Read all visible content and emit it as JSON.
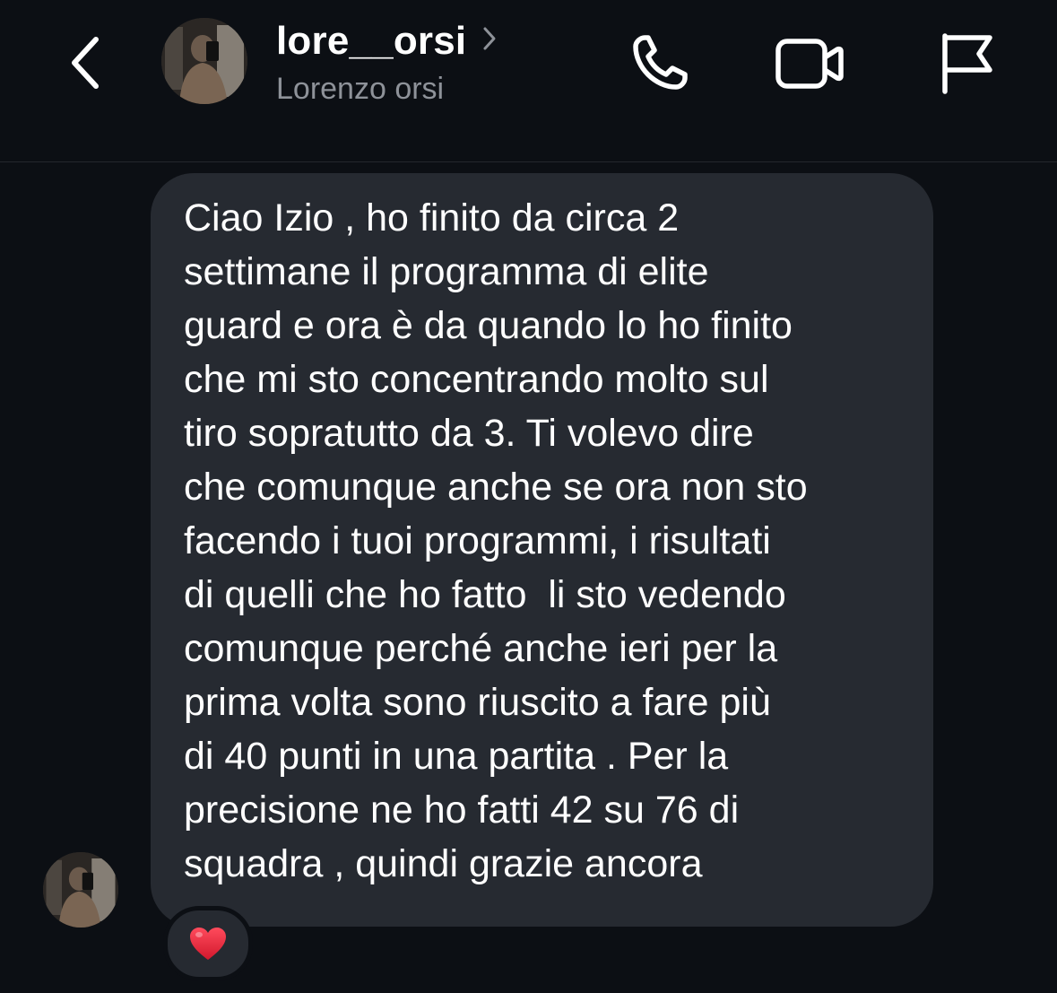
{
  "header": {
    "username": "lore__orsi",
    "full_name": "Lorenzo orsi",
    "back_icon": "chevron-left-icon",
    "username_chevron_icon": "chevron-right-icon",
    "actions": [
      {
        "icon": "phone-icon"
      },
      {
        "icon": "video-camera-icon"
      },
      {
        "icon": "flag-icon"
      }
    ]
  },
  "message": {
    "text": "Ciao Izio , ho finito da circa 2\nsettimane il programma di elite\nguard e ora è da quando lo ho finito\nche mi sto concentrando molto sul\ntiro sopratutto da 3. Ti volevo dire\nche comunque anche se ora non sto\nfacendo i tuoi programmi, i risultati\ndi quelli che ho fatto  li sto vedendo\ncomunque perché anche ieri per la\nprima volta sono riuscito a fare più\ndi 40 punti in una partita . Per la\nprecisione ne ho fatti 42 su 76 di\nsquadra , quindi grazie ancora",
    "reaction": "❤️"
  },
  "colors": {
    "background": "#0c0f14",
    "bubble": "#262a31",
    "secondary_text": "#8e9299",
    "heart": "#e0263a"
  }
}
